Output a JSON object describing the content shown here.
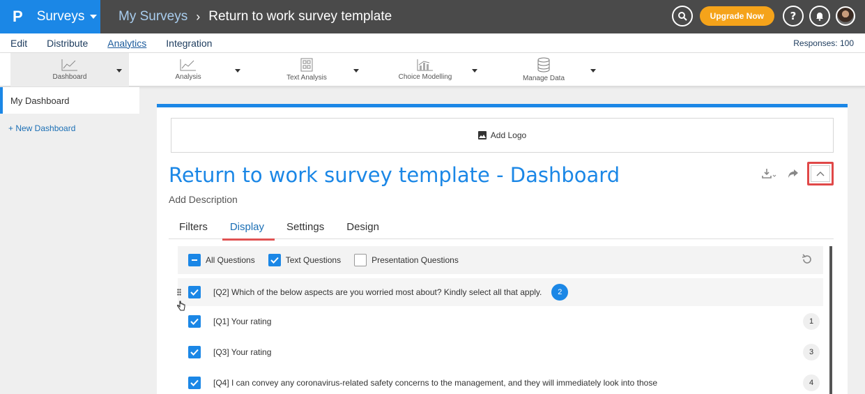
{
  "topbar": {
    "logo": "P",
    "app_name": "Surveys",
    "breadcrumb_parent": "My Surveys",
    "breadcrumb_sep": "›",
    "breadcrumb_current": "Return to work survey template",
    "upgrade_label": "Upgrade Now"
  },
  "menubar": {
    "items": [
      "Edit",
      "Distribute",
      "Analytics",
      "Integration"
    ],
    "active": "Analytics",
    "responses": "Responses: 100"
  },
  "toolbar": {
    "items": [
      {
        "label": "Dashboard",
        "icon": "line-chart-icon"
      },
      {
        "label": "Analysis",
        "icon": "line-chart-icon"
      },
      {
        "label": "Text Analysis",
        "icon": "text-grid-icon"
      },
      {
        "label": "Choice Modelling",
        "icon": "bar-chart-icon"
      },
      {
        "label": "Manage Data",
        "icon": "database-icon"
      }
    ]
  },
  "sidebar": {
    "my_dashboard": "My Dashboard",
    "new_dashboard": "+ New Dashboard"
  },
  "main": {
    "add_logo": "Add Logo",
    "title": "Return to work survey template - Dashboard",
    "add_description": "Add Description",
    "tabs": [
      "Filters",
      "Display",
      "Settings",
      "Design"
    ],
    "active_tab": "Display"
  },
  "filters": {
    "all_questions": "All Questions",
    "text_questions": "Text Questions",
    "presentation_questions": "Presentation Questions"
  },
  "questions": [
    {
      "text": "[Q2] Which of the below aspects are you worried most about? Kindly select all that apply.",
      "number": "2"
    },
    {
      "text": "[Q1] Your rating",
      "number": "1"
    },
    {
      "text": "[Q3] Your rating",
      "number": "3"
    },
    {
      "text": "[Q4] I can convey any coronavirus-related safety concerns to the management, and they will immediately look into those",
      "number": "4"
    }
  ],
  "colors": {
    "brand": "#1b87e6",
    "topbar": "#4a4a4a",
    "upgrade": "#f5a31a",
    "highlight": "#e04848"
  }
}
